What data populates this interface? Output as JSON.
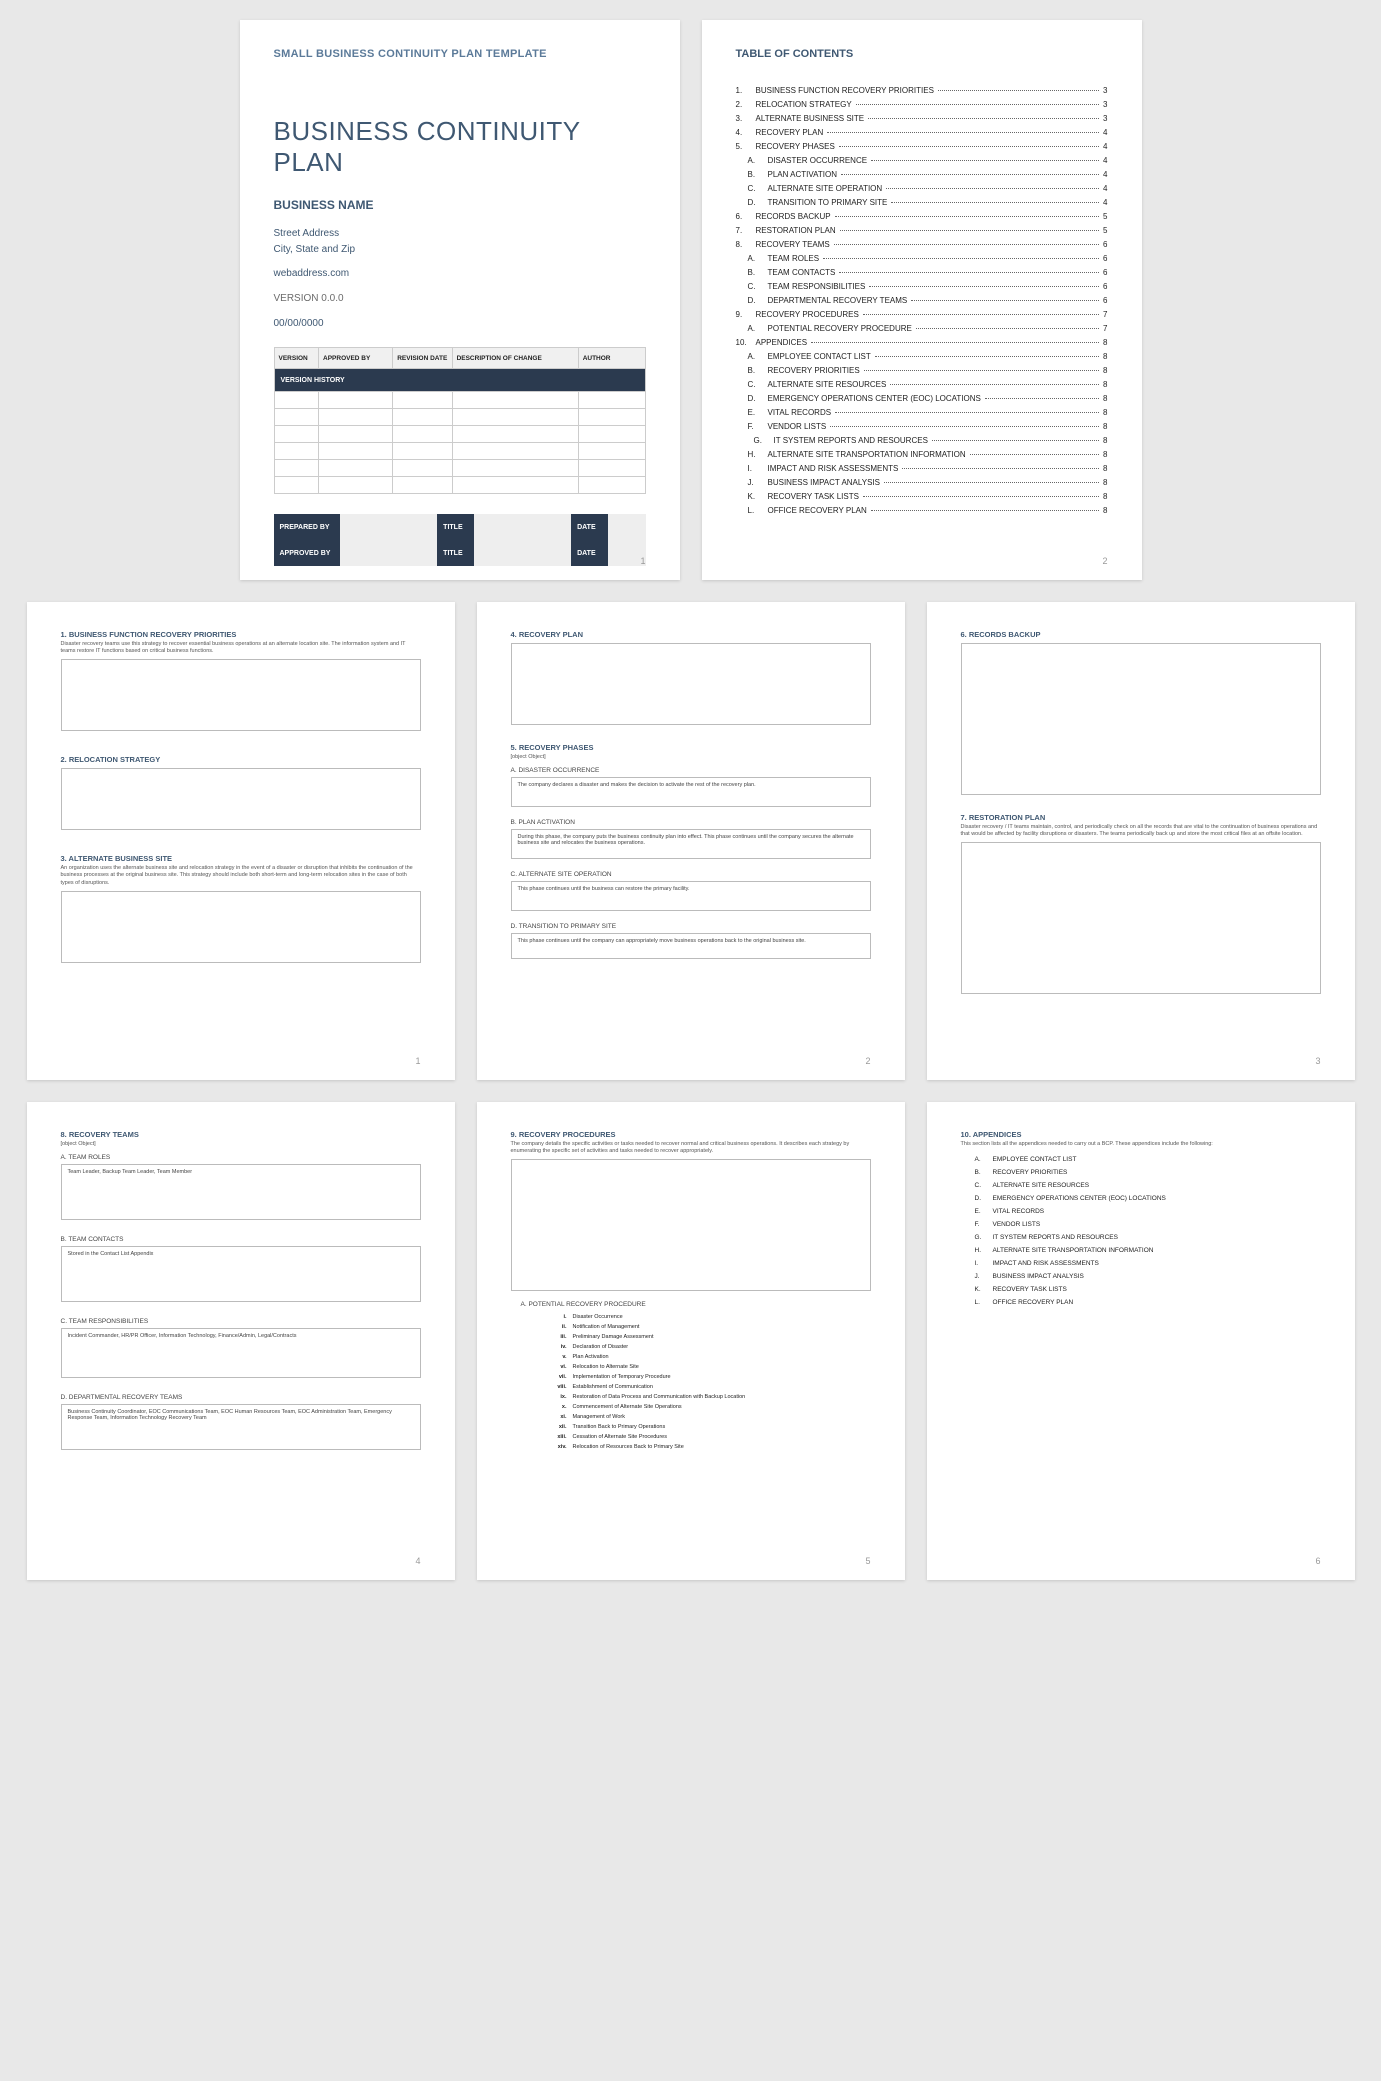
{
  "page1": {
    "template_label": "SMALL BUSINESS CONTINUITY PLAN TEMPLATE",
    "title": "BUSINESS CONTINUITY PLAN",
    "business_name": "BUSINESS NAME",
    "street": "Street Address",
    "city_state_zip": "City, State and Zip",
    "web": "webaddress.com",
    "version": "VERSION 0.0.0",
    "date": "00/00/0000",
    "vh_caption": "VERSION HISTORY",
    "vh_headers": [
      "VERSION",
      "APPROVED BY",
      "REVISION DATE",
      "DESCRIPTION OF CHANGE",
      "AUTHOR"
    ],
    "sign_labels": {
      "prepared": "PREPARED BY",
      "approved": "APPROVED BY",
      "title": "TITLE",
      "date": "DATE"
    },
    "page_num": "1"
  },
  "page2": {
    "toc_title": "TABLE OF CONTENTS",
    "items": [
      {
        "n": "1.",
        "t": "BUSINESS FUNCTION RECOVERY PRIORITIES",
        "p": "3"
      },
      {
        "n": "2.",
        "t": "RELOCATION STRATEGY",
        "p": "3"
      },
      {
        "n": "3.",
        "t": "ALTERNATE BUSINESS SITE",
        "p": "3"
      },
      {
        "n": "4.",
        "t": "RECOVERY PLAN",
        "p": "4"
      },
      {
        "n": "5.",
        "t": "RECOVERY PHASES",
        "p": "4"
      },
      {
        "n": "A.",
        "t": "DISASTER OCCURRENCE",
        "p": "4",
        "sub": true
      },
      {
        "n": "B.",
        "t": "PLAN ACTIVATION",
        "p": "4",
        "sub": true
      },
      {
        "n": "C.",
        "t": "ALTERNATE SITE OPERATION",
        "p": "4",
        "sub": true
      },
      {
        "n": "D.",
        "t": "TRANSITION TO PRIMARY SITE",
        "p": "4",
        "sub": true
      },
      {
        "n": "6.",
        "t": "RECORDS BACKUP",
        "p": "5"
      },
      {
        "n": "7.",
        "t": "RESTORATION PLAN",
        "p": "5"
      },
      {
        "n": "8.",
        "t": "RECOVERY TEAMS",
        "p": "6"
      },
      {
        "n": "A.",
        "t": "TEAM ROLES",
        "p": "6",
        "sub": true
      },
      {
        "n": "B.",
        "t": "TEAM CONTACTS",
        "p": "6",
        "sub": true
      },
      {
        "n": "C.",
        "t": "TEAM RESPONSIBILITIES",
        "p": "6",
        "sub": true
      },
      {
        "n": "D.",
        "t": "DEPARTMENTAL RECOVERY TEAMS",
        "p": "6",
        "sub": true
      },
      {
        "n": "9.",
        "t": "RECOVERY PROCEDURES",
        "p": "7"
      },
      {
        "n": "A.",
        "t": "POTENTIAL RECOVERY PROCEDURE",
        "p": "7",
        "sub": true
      },
      {
        "n": "10.",
        "t": "APPENDICES",
        "p": "8"
      },
      {
        "n": "A.",
        "t": "EMPLOYEE CONTACT LIST",
        "p": "8",
        "sub": true
      },
      {
        "n": "B.",
        "t": "RECOVERY PRIORITIES",
        "p": "8",
        "sub": true
      },
      {
        "n": "C.",
        "t": "ALTERNATE SITE RESOURCES",
        "p": "8",
        "sub": true
      },
      {
        "n": "D.",
        "t": "EMERGENCY OPERATIONS CENTER (EOC) LOCATIONS",
        "p": "8",
        "sub": true
      },
      {
        "n": "E.",
        "t": "VITAL RECORDS",
        "p": "8",
        "sub": true
      },
      {
        "n": "F.",
        "t": "VENDOR LISTS",
        "p": "8",
        "sub": true
      },
      {
        "n": "G.",
        "t": "IT SYSTEM REPORTS AND RESOURCES",
        "p": "8",
        "sub": true,
        "sub2": true
      },
      {
        "n": "H.",
        "t": "ALTERNATE SITE TRANSPORTATION INFORMATION",
        "p": "8",
        "sub": true
      },
      {
        "n": "I.",
        "t": "IMPACT AND RISK ASSESSMENTS",
        "p": "8",
        "sub": true
      },
      {
        "n": "J.",
        "t": "BUSINESS IMPACT ANALYSIS",
        "p": "8",
        "sub": true
      },
      {
        "n": "K.",
        "t": "RECOVERY TASK LISTS",
        "p": "8",
        "sub": true
      },
      {
        "n": "L.",
        "t": "OFFICE RECOVERY PLAN",
        "p": "8",
        "sub": true
      }
    ],
    "page_num": "2"
  },
  "p3": {
    "s1": {
      "h": "1. BUSINESS FUNCTION RECOVERY PRIORITIES",
      "d": "Disaster recovery teams use this strategy to recover essential business operations at an alternate location site. The information system and IT teams restore IT functions based on critical business functions."
    },
    "s2": {
      "h": "2. RELOCATION STRATEGY"
    },
    "s3": {
      "h": "3. ALTERNATE BUSINESS SITE",
      "d": "An organization uses the alternate business site and relocation strategy in the event of a disaster or disruption that inhibits the continuation of the business processes at the original business site. This strategy should include both short-term and long-term relocation sites in the case of both types of disruptions."
    },
    "page_num": "1"
  },
  "p4": {
    "s4": {
      "h": "4. RECOVERY PLAN"
    },
    "s5": {
      "h": "5. RECOVERY PHASES",
      "d": {
        "h": "D. TRANSITION TO PRIMARY SITE",
        "t": "This phase continues until the company can appropriately move business operations back to the original business site."
      },
      "a": {
        "h": "A. DISASTER OCCURRENCE",
        "t": "The company declares a disaster and makes the decision to activate the rest of the recovery plan."
      },
      "b": {
        "h": "B. PLAN ACTIVATION",
        "t": "During this phase, the company puts the business continuity plan into effect. This phase continues until the company secures the alternate business site and relocates the business operations."
      },
      "c": {
        "h": "C. ALTERNATE SITE OPERATION",
        "t": "This phase continues until the business can restore the primary facility."
      }
    },
    "page_num": "2"
  },
  "p5": {
    "s6": {
      "h": "6. RECORDS BACKUP"
    },
    "s7": {
      "h": "7. RESTORATION PLAN",
      "d": "Disaster recovery / IT teams maintain, control, and periodically check on all the records that are vital to the continuation of business operations and that would be affected by facility disruptions or disasters. The teams periodically back up and store the most critical files at an offsite location."
    },
    "page_num": "3"
  },
  "p6": {
    "s8": {
      "h": "8. RECOVERY TEAMS",
      "d": {
        "h": "D. DEPARTMENTAL RECOVERY TEAMS",
        "t": "Business Continuity Coordinator, EOC Communications Team, EOC Human Resources Team, EOC Administration Team, Emergency Response Team, Information Technology Recovery Team"
      },
      "a": {
        "h": "A. TEAM ROLES",
        "t": "Team Leader, Backup Team Leader, Team Member"
      },
      "b": {
        "h": "B. TEAM CONTACTS",
        "t": "Stored in the Contact List Appendix"
      },
      "c": {
        "h": "C. TEAM RESPONSIBILITIES",
        "t": "Incident Commander, HR/PR Officer, Information Technology, Finance/Admin, Legal/Contracts"
      }
    },
    "page_num": "4"
  },
  "p7": {
    "s9": {
      "h": "9. RECOVERY PROCEDURES",
      "d": "The company details the specific activities or tasks needed to recover normal and critical business operations. It describes each strategy by enumerating the specific set of activities and tasks needed to recover appropriately.",
      "a": {
        "h": "A. POTENTIAL RECOVERY PROCEDURE",
        "items": [
          {
            "r": "i.",
            "t": "Disaster Occurrence"
          },
          {
            "r": "ii.",
            "t": "Notification of Management"
          },
          {
            "r": "iii.",
            "t": "Preliminary Damage Assessment"
          },
          {
            "r": "iv.",
            "t": "Declaration of Disaster"
          },
          {
            "r": "v.",
            "t": "Plan Activation"
          },
          {
            "r": "vi.",
            "t": "Relocation to Alternate Site"
          },
          {
            "r": "vii.",
            "t": "Implementation of Temporary Procedure"
          },
          {
            "r": "viii.",
            "t": "Establishment of Communication"
          },
          {
            "r": "ix.",
            "t": "Restoration of Data Process and Communication with Backup Location"
          },
          {
            "r": "x.",
            "t": "Commencement of Alternate Site Operations"
          },
          {
            "r": "xi.",
            "t": "Management of Work"
          },
          {
            "r": "xii.",
            "t": "Transition Back to Primary Operations"
          },
          {
            "r": "xiii.",
            "t": "Cessation of Alternate Site Procedures"
          },
          {
            "r": "xiv.",
            "t": "Relocation of Resources Back to Primary Site"
          }
        ]
      }
    },
    "page_num": "5"
  },
  "p8": {
    "s10": {
      "h": "10.   APPENDICES",
      "d": "This section lists all the appendices needed to carry out a BCP. These appendices include the following:",
      "items": [
        {
          "n": "A.",
          "t": "EMPLOYEE CONTACT LIST"
        },
        {
          "n": "B.",
          "t": "RECOVERY PRIORITIES"
        },
        {
          "n": "C.",
          "t": "ALTERNATE SITE RESOURCES"
        },
        {
          "n": "D.",
          "t": "EMERGENCY OPERATIONS CENTER (EOC) LOCATIONS"
        },
        {
          "n": "E.",
          "t": "VITAL RECORDS"
        },
        {
          "n": "F.",
          "t": "VENDOR LISTS"
        },
        {
          "n": "G.",
          "t": "IT SYSTEM REPORTS AND RESOURCES"
        },
        {
          "n": "H.",
          "t": "ALTERNATE SITE TRANSPORTATION INFORMATION"
        },
        {
          "n": "I.",
          "t": "IMPACT AND RISK ASSESSMENTS"
        },
        {
          "n": "J.",
          "t": "BUSINESS IMPACT ANALYSIS"
        },
        {
          "n": "K.",
          "t": "RECOVERY TASK LISTS"
        },
        {
          "n": "L.",
          "t": "OFFICE RECOVERY PLAN"
        }
      ]
    },
    "page_num": "6"
  }
}
